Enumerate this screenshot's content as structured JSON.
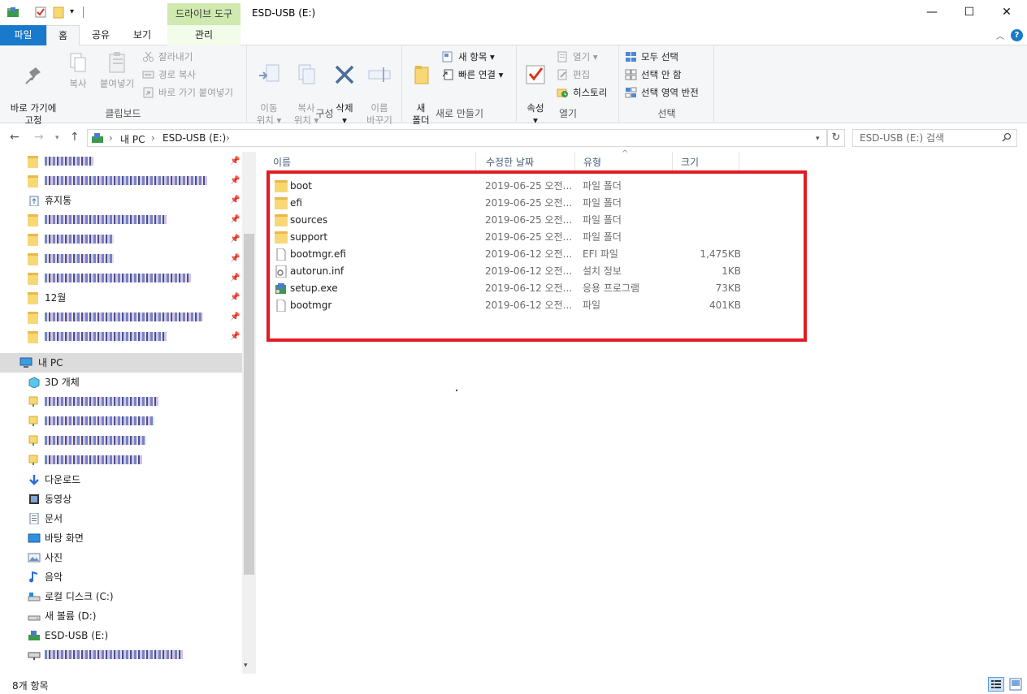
{
  "titlebar": {
    "context_tab_group": "드라이브 도구",
    "title": "ESD-USB (E:)",
    "minimize": "—",
    "maximize": "☐",
    "close": "✕",
    "dropdown": "▾"
  },
  "ribbon_tabs": {
    "file": "파일",
    "home": "홈",
    "share": "공유",
    "view": "보기",
    "manage": "관리",
    "collapse": "︿",
    "help": "?"
  },
  "ribbon": {
    "clipboard": {
      "label": "클립보드",
      "pin": "바로 가기에\n고정",
      "copy": "복사",
      "paste": "붙여넣기",
      "cut": "잘라내기",
      "copy_path": "경로 복사",
      "paste_shortcut": "바로 가기 붙여넣기"
    },
    "organize": {
      "label": "구성",
      "move_to": "이동\n위치 ▾",
      "copy_to": "복사\n위치 ▾",
      "delete": "삭제\n▾",
      "rename": "이름\n바꾸기"
    },
    "new": {
      "label": "새로 만들기",
      "new_folder": "새\n폴더",
      "new_item": "새 항목 ▾",
      "easy_access": "빠른 연결 ▾"
    },
    "open": {
      "label": "열기",
      "properties": "속성\n▾",
      "open": "열기 ▾",
      "edit": "편집",
      "history": "히스토리"
    },
    "select": {
      "label": "선택",
      "select_all": "모두 선택",
      "select_none": "선택 안 함",
      "invert": "선택 영역 반전"
    }
  },
  "navbar": {
    "back": "←",
    "forward": "→",
    "recent": "▾",
    "up": "↑",
    "crumb_sep": "›",
    "crumb_pc": "내 PC",
    "crumb_usb": "ESD-USB (E:)",
    "dropdown": "▾",
    "refresh": "↻",
    "search_placeholder": "ESD-USB (E:) 검색"
  },
  "navpane": {
    "quick_access": [
      {
        "label": "",
        "blurred": true,
        "w": 60
      },
      {
        "label": "",
        "blurred": true,
        "w": 200
      },
      {
        "label": "휴지통"
      },
      {
        "label": "",
        "blurred": true,
        "w": 150
      },
      {
        "label": "",
        "blurred": true,
        "w": 85
      },
      {
        "label": "",
        "blurred": true,
        "w": 85
      },
      {
        "label": "",
        "blurred": true,
        "w": 180
      },
      {
        "label": "12월"
      },
      {
        "label": "",
        "blurred": true,
        "w": 195
      },
      {
        "label": "",
        "blurred": true,
        "w": 150
      }
    ],
    "this_pc": "내 PC",
    "this_pc_items": [
      {
        "label": "3D 개체"
      },
      {
        "label": "",
        "blurred": true,
        "w": 140
      },
      {
        "label": "",
        "blurred": true,
        "w": 135
      },
      {
        "label": "",
        "blurred": true,
        "w": 125
      },
      {
        "label": "",
        "blurred": true,
        "w": 120
      },
      {
        "label": "다운로드"
      },
      {
        "label": "동영상"
      },
      {
        "label": "문서"
      },
      {
        "label": "바탕 화면"
      },
      {
        "label": "사진"
      },
      {
        "label": "음악"
      },
      {
        "label": "로컬 디스크 (C:)"
      },
      {
        "label": "새 볼륨 (D:)"
      },
      {
        "label": "ESD-USB (E:)"
      },
      {
        "label": "",
        "blurred": true,
        "w": 170
      }
    ],
    "pin_glyph": "📌",
    "scroll_down": "▾"
  },
  "filelist": {
    "columns": {
      "name": "이름",
      "date": "수정한 날짜",
      "type": "유형",
      "size": "크기"
    },
    "sort_arrow": "^",
    "rows": [
      {
        "name": "boot",
        "date": "2019-06-25 오전...",
        "type": "파일 폴더",
        "size": "",
        "kind": "folder"
      },
      {
        "name": "efi",
        "date": "2019-06-25 오전...",
        "type": "파일 폴더",
        "size": "",
        "kind": "folder"
      },
      {
        "name": "sources",
        "date": "2019-06-25 오전...",
        "type": "파일 폴더",
        "size": "",
        "kind": "folder"
      },
      {
        "name": "support",
        "date": "2019-06-25 오전...",
        "type": "파일 폴더",
        "size": "",
        "kind": "folder"
      },
      {
        "name": "bootmgr.efi",
        "date": "2019-06-12 오전...",
        "type": "EFI 파일",
        "size": "1,475KB",
        "kind": "file"
      },
      {
        "name": "autorun.inf",
        "date": "2019-06-12 오전...",
        "type": "설치 정보",
        "size": "1KB",
        "kind": "inf"
      },
      {
        "name": "setup.exe",
        "date": "2019-06-12 오전...",
        "type": "응용 프로그램",
        "size": "73KB",
        "kind": "exe"
      },
      {
        "name": "bootmgr",
        "date": "2019-06-12 오전...",
        "type": "파일",
        "size": "401KB",
        "kind": "file"
      }
    ]
  },
  "statusbar": {
    "count": "8개 항목"
  },
  "colors": {
    "accent": "#1979ca",
    "highlight_border": "#e21b23",
    "context_tab": "#cfe9b0",
    "folder": "#f8d775"
  }
}
